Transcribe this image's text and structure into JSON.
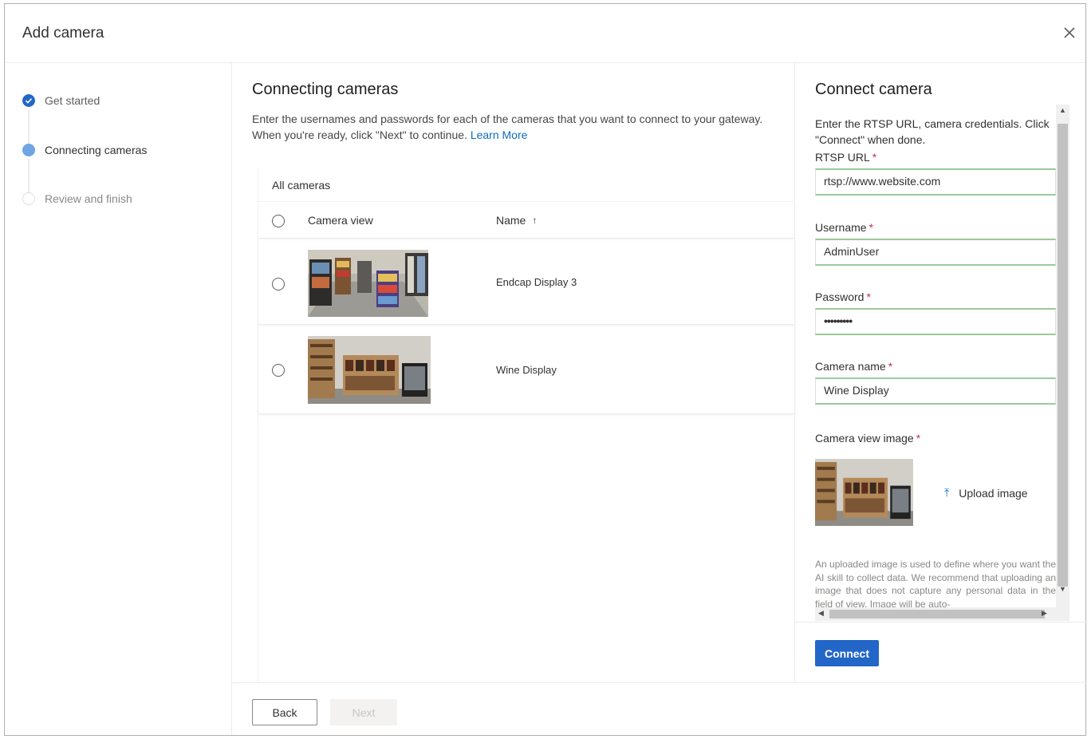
{
  "dialog": {
    "title": "Add camera",
    "close_icon": "close-icon"
  },
  "steps": [
    {
      "label": "Get started",
      "state": "done"
    },
    {
      "label": "Connecting cameras",
      "state": "current"
    },
    {
      "label": "Review and finish",
      "state": "pending"
    }
  ],
  "main": {
    "title": "Connecting cameras",
    "description": "Enter the usernames and passwords for each of the cameras that you want to connect to your gateway. When you're ready, click \"Next\" to continue.",
    "learn_more": "Learn More",
    "grid_title": "All cameras",
    "columns": {
      "camera_view": "Camera view",
      "name": "Name",
      "sort_icon": "arrow-up-icon"
    },
    "rows": [
      {
        "name": "Endcap Display 3",
        "thumbnail": "store-aisle-photo"
      },
      {
        "name": "Wine Display",
        "thumbnail": "wine-shelves-photo"
      }
    ]
  },
  "panel": {
    "title": "Connect camera",
    "description": "Enter the RTSP URL, camera credentials. Click \"Connect\" when done.",
    "fields": {
      "rtsp": {
        "label": "RTSP URL",
        "value": "rtsp://www.website.com"
      },
      "username": {
        "label": "Username",
        "value": "AdminUser"
      },
      "password": {
        "label": "Password",
        "value": "•••••••••"
      },
      "camera_name": {
        "label": "Camera name",
        "value": "Wine Display"
      }
    },
    "required_mark": "*",
    "image_label": "Camera view image",
    "upload_label": "Upload image",
    "note": "An uploaded image is used to define where you want the AI skill to collect data. We recommend that uploading an image that does not capture any personal data in the field of view. Image will be auto-",
    "connect_label": "Connect"
  },
  "footer": {
    "back_label": "Back",
    "next_label": "Next"
  },
  "colors": {
    "accent": "#0f6cbd",
    "primary_button": "#2266c8",
    "step_done": "#2266c8",
    "step_current": "#6ea6e3",
    "required": "#c4314b",
    "field_border": "#9bc99b"
  }
}
